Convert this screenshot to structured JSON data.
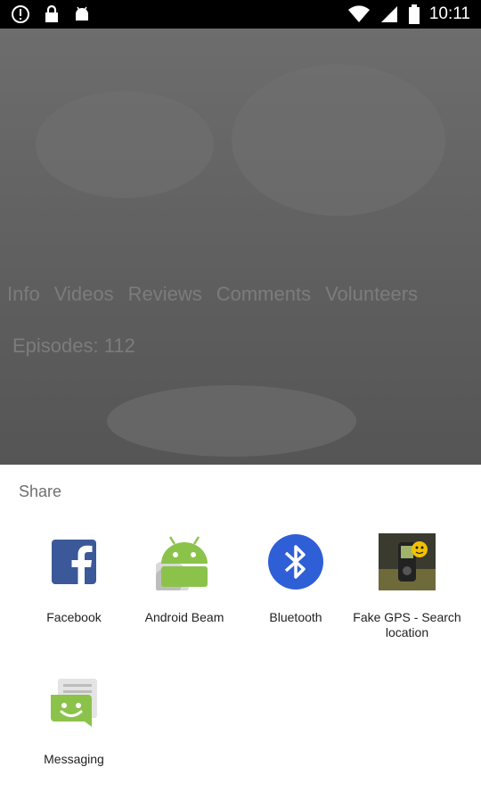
{
  "status_bar": {
    "time": "10:11"
  },
  "background": {
    "tabs": [
      "Info",
      "Videos",
      "Reviews",
      "Comments",
      "Volunteers"
    ],
    "episodes_label": "Episodes: 112"
  },
  "share_sheet": {
    "title": "Share",
    "apps": [
      {
        "label": "Facebook",
        "icon": "facebook-icon"
      },
      {
        "label": "Android Beam",
        "icon": "android-beam-icon"
      },
      {
        "label": "Bluetooth",
        "icon": "bluetooth-icon"
      },
      {
        "label": "Fake GPS - Search location",
        "icon": "fake-gps-icon"
      },
      {
        "label": "Messaging",
        "icon": "messaging-icon"
      }
    ]
  },
  "colors": {
    "facebook": "#3b5998",
    "android_green": "#8bc34a",
    "bluetooth": "#2f5fd6",
    "messaging_green": "#8bc34a"
  }
}
